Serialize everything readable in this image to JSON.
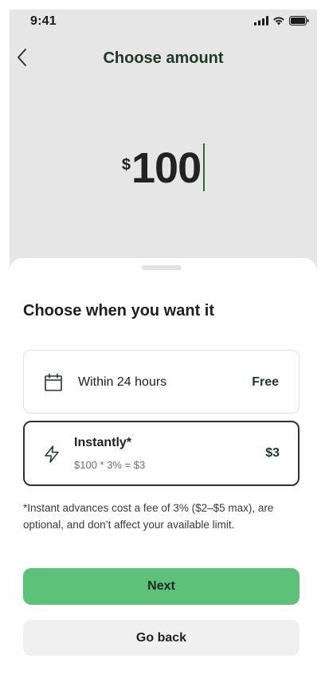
{
  "status_bar": {
    "time": "9:41",
    "icons": [
      "signal-icon",
      "wifi-icon",
      "battery-icon"
    ]
  },
  "header": {
    "title": "Choose amount",
    "back_icon": "chevron-left-icon"
  },
  "amount": {
    "currency": "$",
    "value": "100"
  },
  "sheet": {
    "title": "Choose when you want it",
    "options": [
      {
        "icon": "calendar-icon",
        "label": "Within 24 hours",
        "price": "Free",
        "selected": false
      },
      {
        "icon": "lightning-icon",
        "label": "Instantly*",
        "sublabel": "$100 * 3% = $3",
        "price": "$3",
        "selected": true
      }
    ],
    "disclaimer": "*Instant advances cost a fee of 3% ($2–$5 max), are optional, and don’t affect your available limit."
  },
  "actions": {
    "next_label": "Next",
    "back_label": "Go back"
  },
  "colors": {
    "accent": "#5ec179",
    "title_green": "#1e3a26",
    "top_background": "#e6e6e6",
    "caret": "#2e6b41"
  }
}
